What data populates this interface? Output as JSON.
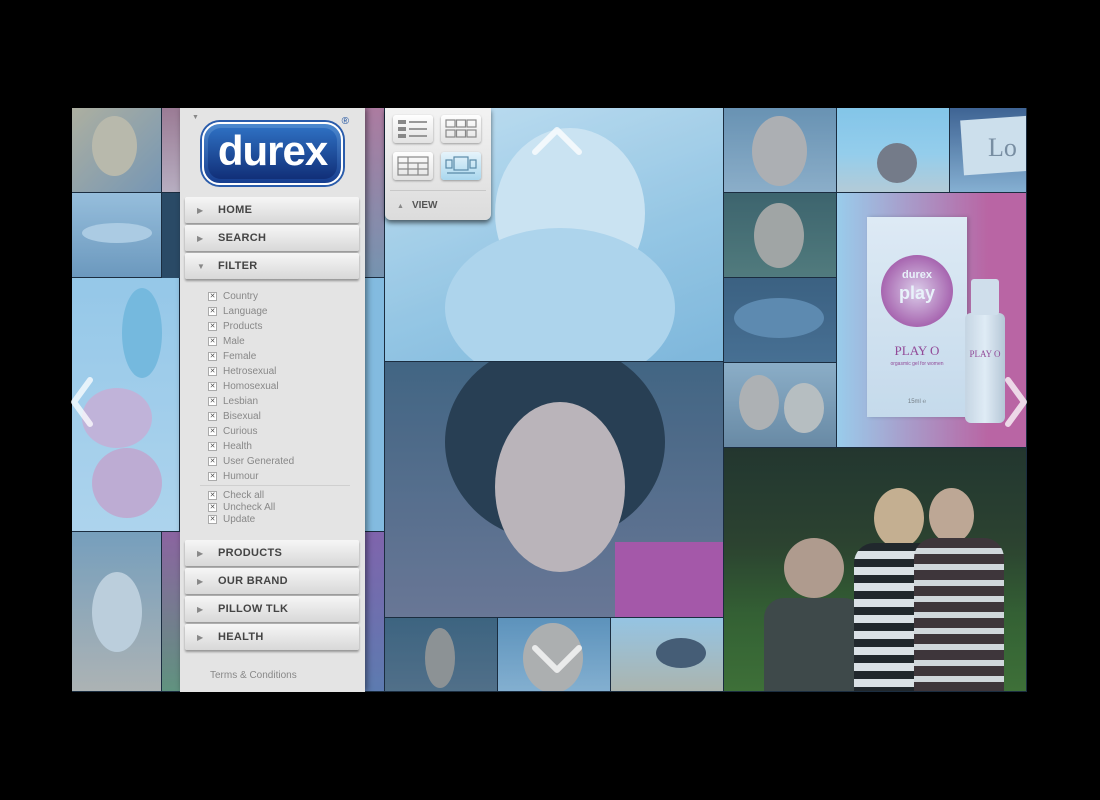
{
  "brand": {
    "logo_text": "durex",
    "registered": "®"
  },
  "nav": {
    "home": "HOME",
    "search": "SEARCH",
    "filter": "FILTER",
    "products": "PRODUCTS",
    "our_brand": "OUR BRAND",
    "pillow_tlk": "PILLOW TLK",
    "health": "HEALTH"
  },
  "filter_items": [
    "Country",
    "Language",
    "Products",
    "Male",
    "Female",
    "Hetrosexual",
    "Homosexual",
    "Lesbian",
    "Bisexual",
    "Curious",
    "Health",
    "User Generated",
    "Humour"
  ],
  "filter_actions": [
    "Check all",
    "Uncheck All",
    "Update"
  ],
  "footer": {
    "terms": "Terms & Conditions"
  },
  "view": {
    "label": "VIEW",
    "modes": [
      "list-view-icon",
      "grid-view-icon",
      "table-view-icon",
      "gallery-view-icon"
    ],
    "active_mode": "gallery-view-icon"
  },
  "images": {
    "product_box_brand": "durex",
    "product_box_line": "play",
    "product_name": "PLAY O",
    "product_tagline": "orgasmic gel for women",
    "product_size": "15ml ℮",
    "bottle_name": "PLAY O",
    "note_text": "Lo"
  },
  "colors": {
    "brand_blue": "#1b4f9e",
    "tile_tint": "#7cc4ea",
    "background": "#000000"
  }
}
